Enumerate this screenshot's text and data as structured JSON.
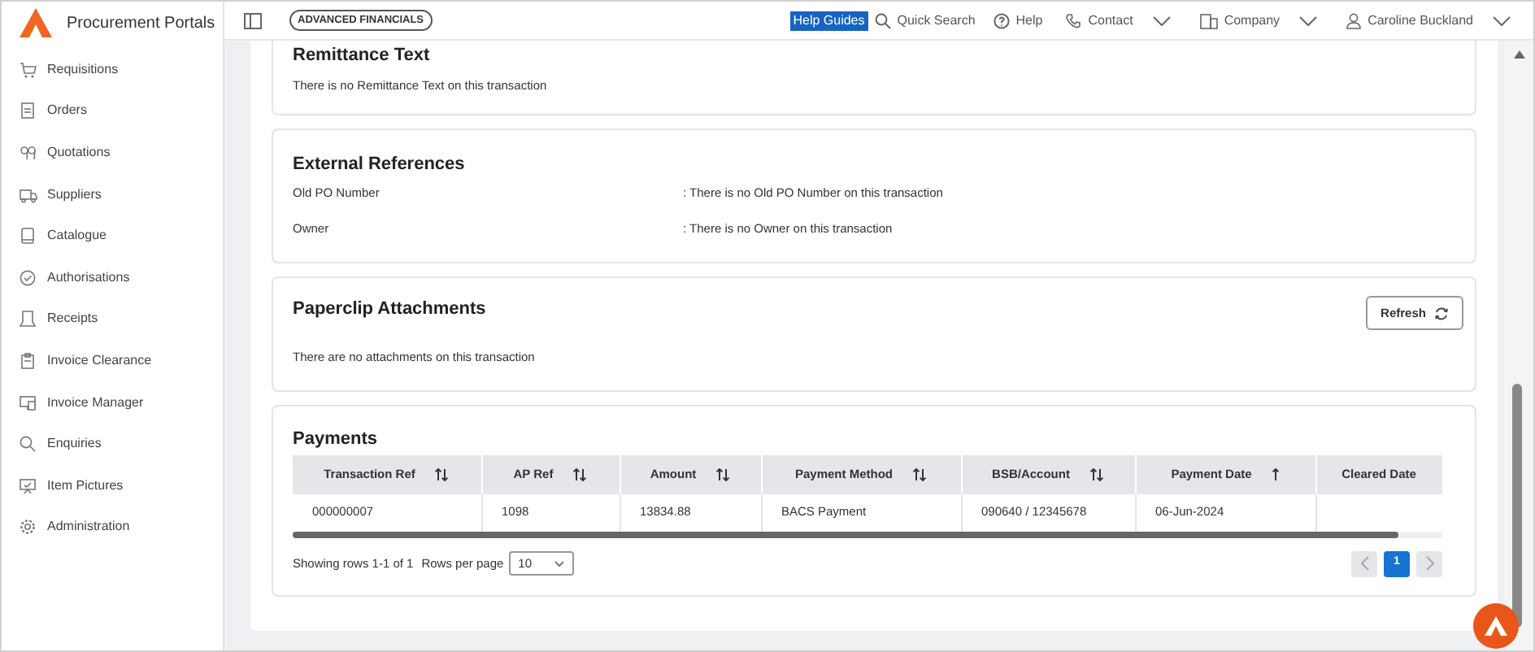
{
  "app": {
    "title": "Procurement Portals"
  },
  "topbar": {
    "badge": "ADVANCED FINANCIALS",
    "help_guides": "Help Guides",
    "quick_search": "Quick Search",
    "help": "Help",
    "contact": "Contact",
    "company": "Company",
    "user": "Caroline Buckland"
  },
  "sidebar": {
    "items": [
      {
        "label": "Requisitions"
      },
      {
        "label": "Orders"
      },
      {
        "label": "Quotations"
      },
      {
        "label": "Suppliers"
      },
      {
        "label": "Catalogue"
      },
      {
        "label": "Authorisations"
      },
      {
        "label": "Receipts"
      },
      {
        "label": "Invoice Clearance"
      },
      {
        "label": "Invoice Manager"
      },
      {
        "label": "Enquiries"
      },
      {
        "label": "Item Pictures"
      },
      {
        "label": "Administration"
      }
    ]
  },
  "remittance": {
    "title": "Remittance Text",
    "text": "There is no Remittance Text on this transaction"
  },
  "external_references": {
    "title": "External References",
    "rows": [
      {
        "label": "Old PO Number",
        "value": ": There is no Old PO Number on this transaction"
      },
      {
        "label": "Owner",
        "value": ": There is no Owner on this transaction"
      }
    ]
  },
  "attachments": {
    "title": "Paperclip Attachments",
    "refresh": "Refresh",
    "text": "There are no attachments on this transaction"
  },
  "payments": {
    "title": "Payments",
    "columns": [
      {
        "label": "Transaction Ref",
        "sortable": true,
        "sorted": false
      },
      {
        "label": "AP Ref",
        "sortable": true,
        "sorted": false
      },
      {
        "label": "Amount",
        "sortable": true,
        "sorted": false
      },
      {
        "label": "Payment Method",
        "sortable": true,
        "sorted": false
      },
      {
        "label": "BSB/Account",
        "sortable": true,
        "sorted": false
      },
      {
        "label": "Payment Date",
        "sortable": true,
        "sorted": true
      },
      {
        "label": "Cleared Date",
        "sortable": false,
        "sorted": false
      }
    ],
    "rows": [
      [
        "000000007",
        "1098",
        "13834.88",
        "BACS Payment",
        "090640 / 12345678",
        "06-Jun-2024"
      ]
    ],
    "showing": "Showing rows 1-1 of 1",
    "rows_per_page_label": "Rows per page",
    "rows_per_page": "10",
    "pages": [
      {
        "label": "1",
        "selected": true
      }
    ]
  }
}
